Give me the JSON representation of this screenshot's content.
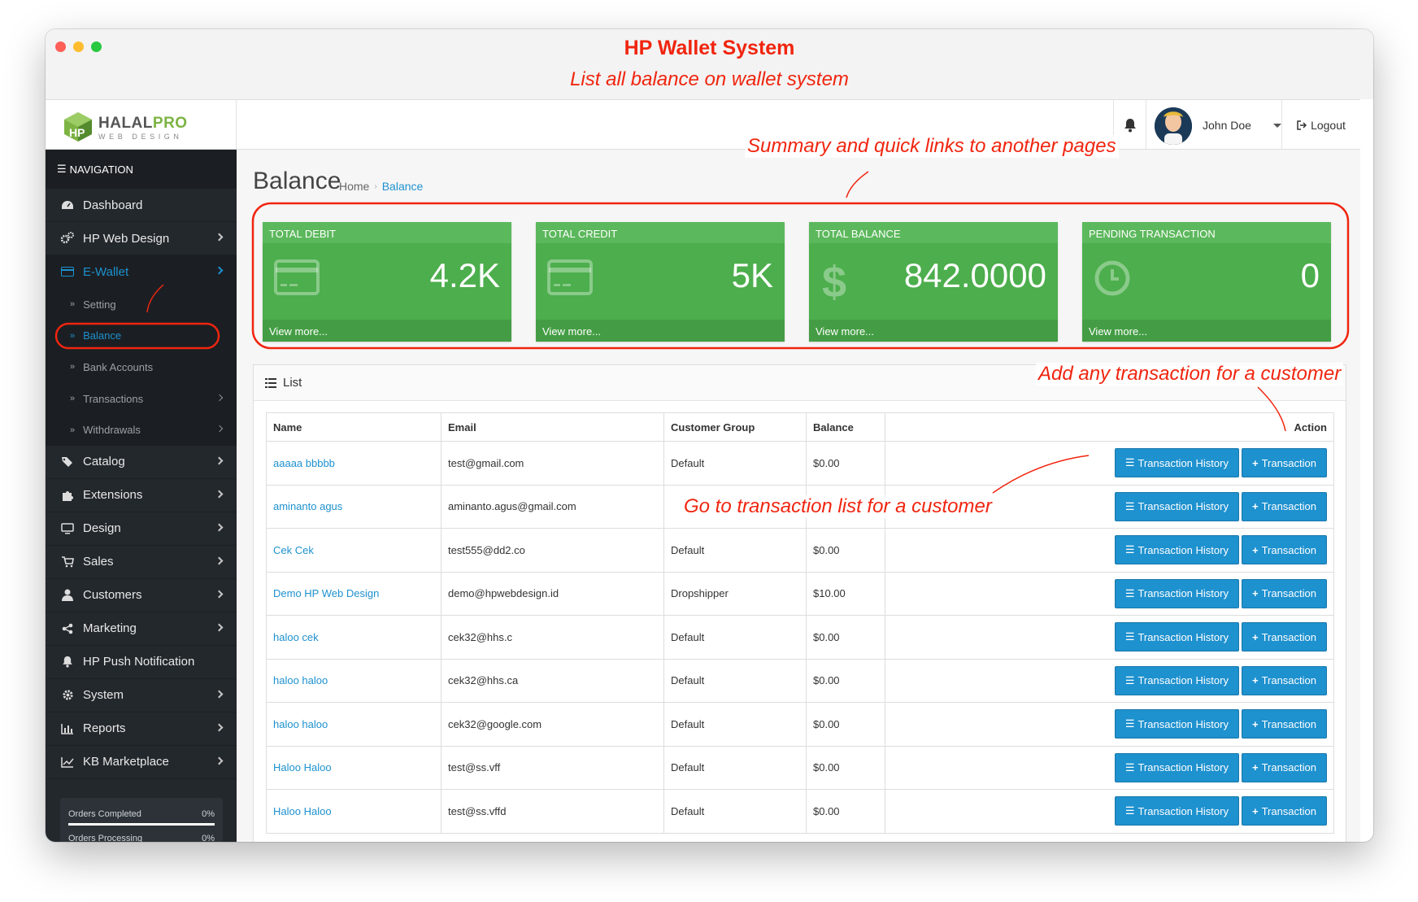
{
  "window": {
    "title": "HP Wallet System",
    "subtitle": "List all balance on wallet system"
  },
  "brand": {
    "name_part1": "HALAL",
    "name_part2": "PRO",
    "tagline": "WEB DESIGN"
  },
  "header": {
    "user_name": "John Doe",
    "logout_label": "Logout"
  },
  "sidebar": {
    "nav_title": "NAVIGATION",
    "items_top": [
      {
        "label": "Dashboard",
        "icon": "dashboard-icon"
      },
      {
        "label": "HP Web Design",
        "icon": "cogs-icon"
      },
      {
        "label": "E-Wallet",
        "icon": "credit-card-icon"
      }
    ],
    "sub_items": [
      {
        "label": "Setting"
      },
      {
        "label": "Balance"
      },
      {
        "label": "Bank Accounts"
      },
      {
        "label": "Transactions"
      },
      {
        "label": "Withdrawals"
      }
    ],
    "items_bottom": [
      {
        "label": "Catalog",
        "icon": "tags-icon"
      },
      {
        "label": "Extensions",
        "icon": "puzzle-icon"
      },
      {
        "label": "Design",
        "icon": "desktop-icon"
      },
      {
        "label": "Sales",
        "icon": "cart-icon"
      },
      {
        "label": "Customers",
        "icon": "user-icon"
      },
      {
        "label": "Marketing",
        "icon": "share-icon"
      },
      {
        "label": "HP Push Notification",
        "icon": "bell-icon"
      },
      {
        "label": "System",
        "icon": "gear-icon"
      },
      {
        "label": "Reports",
        "icon": "bar-chart-icon"
      },
      {
        "label": "KB Marketplace",
        "icon": "line-chart-icon"
      }
    ],
    "progress": [
      {
        "label": "Orders Completed",
        "value": "0%"
      },
      {
        "label": "Orders Processing",
        "value": "0%"
      }
    ]
  },
  "page": {
    "title": "Balance",
    "breadcrumb": [
      "Home",
      "Balance"
    ]
  },
  "tiles": [
    {
      "title": "TOTAL DEBIT",
      "value": "4.2K",
      "link": "View more...",
      "icon": "credit-card-icon"
    },
    {
      "title": "TOTAL CREDIT",
      "value": "5K",
      "link": "View more...",
      "icon": "credit-card-icon"
    },
    {
      "title": "TOTAL BALANCE",
      "value": "842.0000",
      "link": "View more...",
      "icon": "dollar-icon"
    },
    {
      "title": "PENDING TRANSACTION",
      "value": "0",
      "link": "View more...",
      "icon": "clock-icon"
    }
  ],
  "list": {
    "title": "List",
    "columns": [
      "Name",
      "Email",
      "Customer Group",
      "Balance",
      "Action"
    ],
    "history_label": "Transaction History",
    "add_label": "Transaction",
    "rows": [
      {
        "name": "aaaaa bbbbb",
        "email": "test@gmail.com",
        "group": "Default",
        "balance": "$0.00"
      },
      {
        "name": "aminanto agus",
        "email": "aminanto.agus@gmail.com",
        "group": "",
        "balance": ""
      },
      {
        "name": "Cek Cek",
        "email": "test555@dd2.co",
        "group": "Default",
        "balance": "$0.00"
      },
      {
        "name": "Demo HP Web Design",
        "email": "demo@hpwebdesign.id",
        "group": "Dropshipper",
        "balance": "$10.00"
      },
      {
        "name": "haloo cek",
        "email": "cek32@hhs.c",
        "group": "Default",
        "balance": "$0.00"
      },
      {
        "name": "haloo haloo",
        "email": "cek32@hhs.ca",
        "group": "Default",
        "balance": "$0.00"
      },
      {
        "name": "haloo haloo",
        "email": "cek32@google.com",
        "group": "Default",
        "balance": "$0.00"
      },
      {
        "name": "Haloo Haloo",
        "email": "test@ss.vff",
        "group": "Default",
        "balance": "$0.00"
      },
      {
        "name": "Haloo Haloo",
        "email": "test@ss.vffd",
        "group": "Default",
        "balance": "$0.00"
      }
    ]
  },
  "annotations": {
    "summary": "Summary and quick links to another pages",
    "add_tx": "Add any transaction for a customer",
    "go_list": "Go to transaction list for a customer"
  },
  "colors": {
    "accent": "#1e91cf",
    "tile_green": "#4cae4c",
    "annotation_red": "#f0250f",
    "sidebar_bg": "#23282d"
  }
}
